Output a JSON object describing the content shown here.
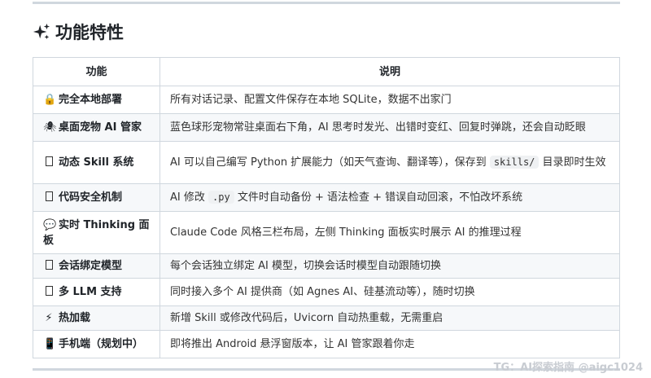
{
  "section": {
    "title": "功能特性",
    "icon": "sparkles-icon"
  },
  "table": {
    "headers": [
      "功能",
      "说明"
    ],
    "rows": [
      {
        "icon": "🔒",
        "feature": "完全本地部署",
        "desc": [
          "所有对话记录、配置文件保存在本地 SQLite，数据不出家门"
        ]
      },
      {
        "icon": "🕷",
        "feature": "桌面宠物 AI 管家",
        "desc": [
          "蓝色球形宠物常驻桌面右下角，AI 思考时发光、出错时变红、回复时弹跳，还会自动眨眼"
        ]
      },
      {
        "icon": "box",
        "feature": "动态 Skill 系统",
        "desc": [
          "AI 可以自己编写 Python 扩展能力（如天气查询、翻译等），保存到 ",
          "skills/",
          " 目录即时生效"
        ]
      },
      {
        "icon": "box",
        "feature": "代码安全机制",
        "desc": [
          "AI 修改 ",
          ".py",
          " 文件时自动备份 + 语法检查 + 错误自动回滚，不怕改坏系统"
        ]
      },
      {
        "icon": "💬",
        "feature": "实时 Thinking 面板",
        "desc": [
          "Claude Code 风格三栏布局，左侧 Thinking 面板实时展示 AI 的推理过程"
        ]
      },
      {
        "icon": "box",
        "feature": "会话绑定模型",
        "desc": [
          "每个会话独立绑定 AI 模型，切换会话时模型自动跟随切换"
        ]
      },
      {
        "icon": "box",
        "feature": "多 LLM 支持",
        "desc": [
          "同时接入多个 AI 提供商（如 Agnes AI、硅基流动等），随时切换"
        ]
      },
      {
        "icon": "⚡",
        "feature": "热加载",
        "desc": [
          "新增 Skill 或修改代码后，Uvicorn 自动热重载，无需重启"
        ]
      },
      {
        "icon": "📱",
        "feature": "手机端（规划中）",
        "desc": [
          "即将推出 Android 悬浮窗版本，让 AI 管家跟着你走"
        ]
      }
    ]
  },
  "watermark": "TG：AI探索指南 @aigc1024"
}
